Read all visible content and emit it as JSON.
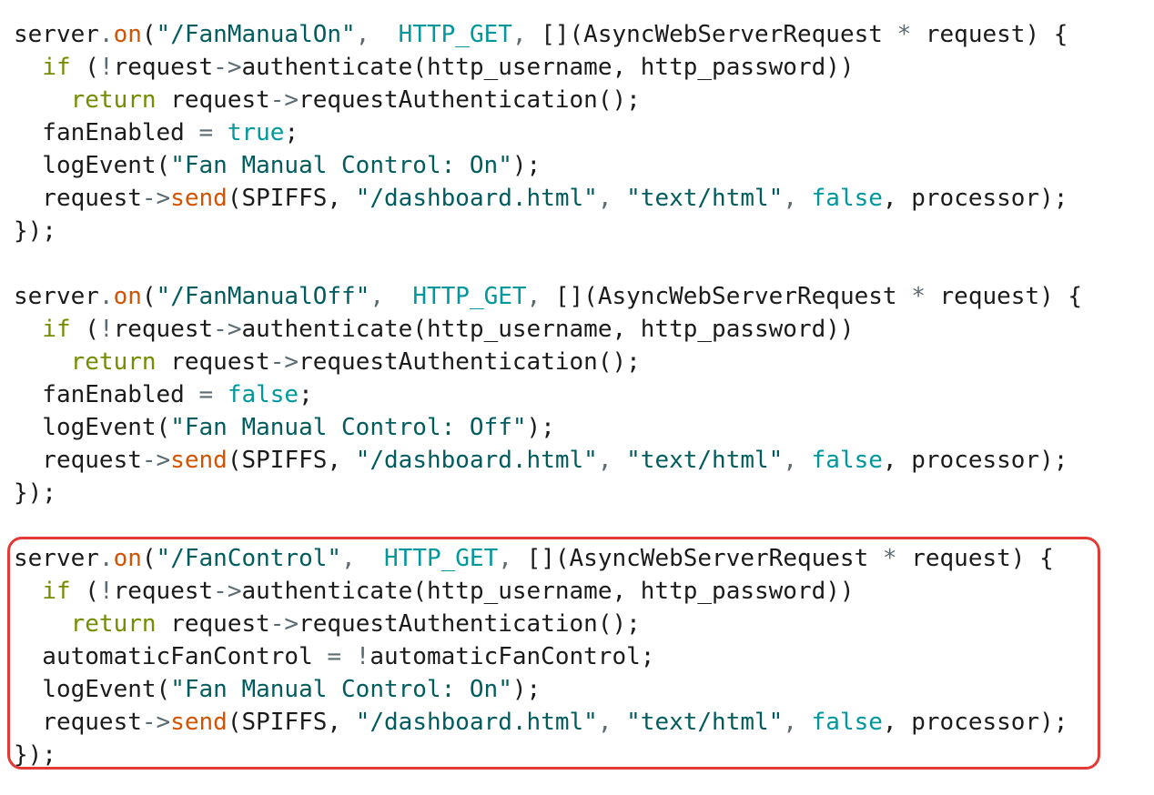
{
  "colors": {
    "plain": "#1b1b1b",
    "operator": "#5b6b73",
    "method": "#d35400",
    "string": "#005c5f",
    "constant": "#00979d",
    "keyword": "#728e00",
    "boolean": "#00979d",
    "highlight_border": "#e53935"
  },
  "code_lines": [
    [
      [
        "server",
        "plain"
      ],
      [
        ".",
        "op"
      ],
      [
        "on",
        "method"
      ],
      [
        "(",
        "plain"
      ],
      [
        "\"/FanManualOn\"",
        "string"
      ],
      [
        ",  ",
        "op"
      ],
      [
        "HTTP_GET",
        "const"
      ],
      [
        ", ",
        "op"
      ],
      [
        "[](AsyncWebServerRequest ",
        "plain"
      ],
      [
        "*",
        "op"
      ],
      [
        " request) {",
        "plain"
      ]
    ],
    [
      [
        "  ",
        "plain"
      ],
      [
        "if",
        "keyword"
      ],
      [
        " (",
        "plain"
      ],
      [
        "!",
        "op"
      ],
      [
        "request",
        "plain"
      ],
      [
        "->",
        "op"
      ],
      [
        "authenticate(http_username, http_password))",
        "plain"
      ]
    ],
    [
      [
        "    ",
        "plain"
      ],
      [
        "return",
        "keyword"
      ],
      [
        " request",
        "plain"
      ],
      [
        "->",
        "op"
      ],
      [
        "requestAuthentication();",
        "plain"
      ]
    ],
    [
      [
        "  fanEnabled ",
        "plain"
      ],
      [
        "=",
        "op"
      ],
      [
        " ",
        "plain"
      ],
      [
        "true",
        "bool"
      ],
      [
        ";",
        "plain"
      ]
    ],
    [
      [
        "  logEvent(",
        "plain"
      ],
      [
        "\"Fan Manual Control: On\"",
        "string"
      ],
      [
        ");",
        "plain"
      ]
    ],
    [
      [
        "  request",
        "plain"
      ],
      [
        "->",
        "op"
      ],
      [
        "send",
        "method"
      ],
      [
        "(SPIFFS, ",
        "plain"
      ],
      [
        "\"/dashboard.html\"",
        "string"
      ],
      [
        ", ",
        "op"
      ],
      [
        "\"text/html\"",
        "string"
      ],
      [
        ", ",
        "op"
      ],
      [
        "false",
        "bool"
      ],
      [
        ", processor);",
        "plain"
      ]
    ],
    [
      [
        "});",
        "plain"
      ]
    ],
    [
      [
        "",
        "plain"
      ]
    ],
    [
      [
        "server",
        "plain"
      ],
      [
        ".",
        "op"
      ],
      [
        "on",
        "method"
      ],
      [
        "(",
        "plain"
      ],
      [
        "\"/FanManualOff\"",
        "string"
      ],
      [
        ",  ",
        "op"
      ],
      [
        "HTTP_GET",
        "const"
      ],
      [
        ", ",
        "op"
      ],
      [
        "[](AsyncWebServerRequest ",
        "plain"
      ],
      [
        "*",
        "op"
      ],
      [
        " request) {",
        "plain"
      ]
    ],
    [
      [
        "  ",
        "plain"
      ],
      [
        "if",
        "keyword"
      ],
      [
        " (",
        "plain"
      ],
      [
        "!",
        "op"
      ],
      [
        "request",
        "plain"
      ],
      [
        "->",
        "op"
      ],
      [
        "authenticate(http_username, http_password))",
        "plain"
      ]
    ],
    [
      [
        "    ",
        "plain"
      ],
      [
        "return",
        "keyword"
      ],
      [
        " request",
        "plain"
      ],
      [
        "->",
        "op"
      ],
      [
        "requestAuthentication();",
        "plain"
      ]
    ],
    [
      [
        "  fanEnabled ",
        "plain"
      ],
      [
        "=",
        "op"
      ],
      [
        " ",
        "plain"
      ],
      [
        "false",
        "bool"
      ],
      [
        ";",
        "plain"
      ]
    ],
    [
      [
        "  logEvent(",
        "plain"
      ],
      [
        "\"Fan Manual Control: Off\"",
        "string"
      ],
      [
        ");",
        "plain"
      ]
    ],
    [
      [
        "  request",
        "plain"
      ],
      [
        "->",
        "op"
      ],
      [
        "send",
        "method"
      ],
      [
        "(SPIFFS, ",
        "plain"
      ],
      [
        "\"/dashboard.html\"",
        "string"
      ],
      [
        ", ",
        "op"
      ],
      [
        "\"text/html\"",
        "string"
      ],
      [
        ", ",
        "op"
      ],
      [
        "false",
        "bool"
      ],
      [
        ", processor);",
        "plain"
      ]
    ],
    [
      [
        "});",
        "plain"
      ]
    ],
    [
      [
        "",
        "plain"
      ]
    ],
    [
      [
        "server",
        "plain"
      ],
      [
        ".",
        "op"
      ],
      [
        "on",
        "method"
      ],
      [
        "(",
        "plain"
      ],
      [
        "\"/FanControl\"",
        "string"
      ],
      [
        ",  ",
        "op"
      ],
      [
        "HTTP_GET",
        "const"
      ],
      [
        ", ",
        "op"
      ],
      [
        "[](AsyncWebServerRequest ",
        "plain"
      ],
      [
        "*",
        "op"
      ],
      [
        " request) {",
        "plain"
      ]
    ],
    [
      [
        "  ",
        "plain"
      ],
      [
        "if",
        "keyword"
      ],
      [
        " (",
        "plain"
      ],
      [
        "!",
        "op"
      ],
      [
        "request",
        "plain"
      ],
      [
        "->",
        "op"
      ],
      [
        "authenticate(http_username, http_password))",
        "plain"
      ]
    ],
    [
      [
        "    ",
        "plain"
      ],
      [
        "return",
        "keyword"
      ],
      [
        " request",
        "plain"
      ],
      [
        "->",
        "op"
      ],
      [
        "requestAuthentication();",
        "plain"
      ]
    ],
    [
      [
        "  automaticFanControl ",
        "plain"
      ],
      [
        "=",
        "op"
      ],
      [
        " ",
        "plain"
      ],
      [
        "!",
        "op"
      ],
      [
        "automaticFanControl;",
        "plain"
      ]
    ],
    [
      [
        "  logEvent(",
        "plain"
      ],
      [
        "\"Fan Manual Control: On\"",
        "string"
      ],
      [
        ");",
        "plain"
      ]
    ],
    [
      [
        "  request",
        "plain"
      ],
      [
        "->",
        "op"
      ],
      [
        "send",
        "method"
      ],
      [
        "(SPIFFS, ",
        "plain"
      ],
      [
        "\"/dashboard.html\"",
        "string"
      ],
      [
        ", ",
        "op"
      ],
      [
        "\"text/html\"",
        "string"
      ],
      [
        ", ",
        "op"
      ],
      [
        "false",
        "bool"
      ],
      [
        ", processor);",
        "plain"
      ]
    ],
    [
      [
        "});",
        "plain"
      ]
    ]
  ]
}
